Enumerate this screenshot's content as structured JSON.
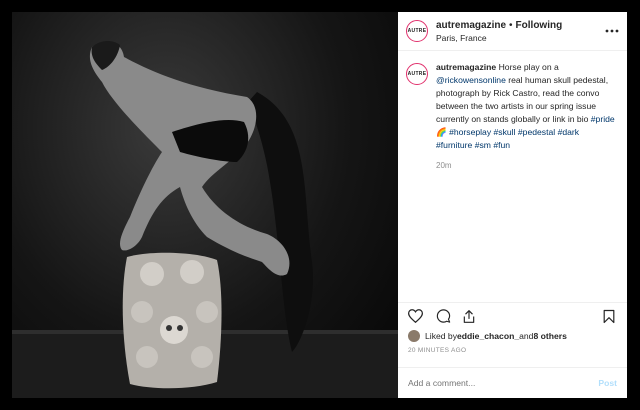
{
  "header": {
    "avatar_text": "AUTRE",
    "username": "autremagazine",
    "separator": "•",
    "follow_state": "Following",
    "location": "Paris, France",
    "more_icon": "more-dots-icon"
  },
  "caption": {
    "username": "autremagazine",
    "parts": [
      "Horse play on a ",
      "@rickowensonline",
      " real human skull pedestal, photograph by Rick Castro, read the convo between the two artists in our spring issue currently on stands globally or link in bio ",
      "#pride",
      "🌈",
      " ",
      "#horseplay",
      " ",
      "#skull",
      " ",
      "#pedestal",
      " ",
      "#dark",
      " ",
      "#furniture",
      " ",
      "#sm",
      " ",
      "#fun"
    ],
    "time": "20m"
  },
  "actions": {
    "like_icon": "heart-icon",
    "comment_icon": "comment-icon",
    "share_icon": "share-icon",
    "save_icon": "bookmark-icon"
  },
  "likes": {
    "prefix": "Liked by ",
    "user": "eddie_chacon_",
    "middle": " and ",
    "others": "8 others"
  },
  "timestamp": "20 MINUTES AGO",
  "add_comment": {
    "placeholder": "Add a comment...",
    "post_label": "Post"
  },
  "colors": {
    "link": "#00376b",
    "post_disabled": "#b2dffc",
    "avatar_ring": "#e1306c"
  }
}
